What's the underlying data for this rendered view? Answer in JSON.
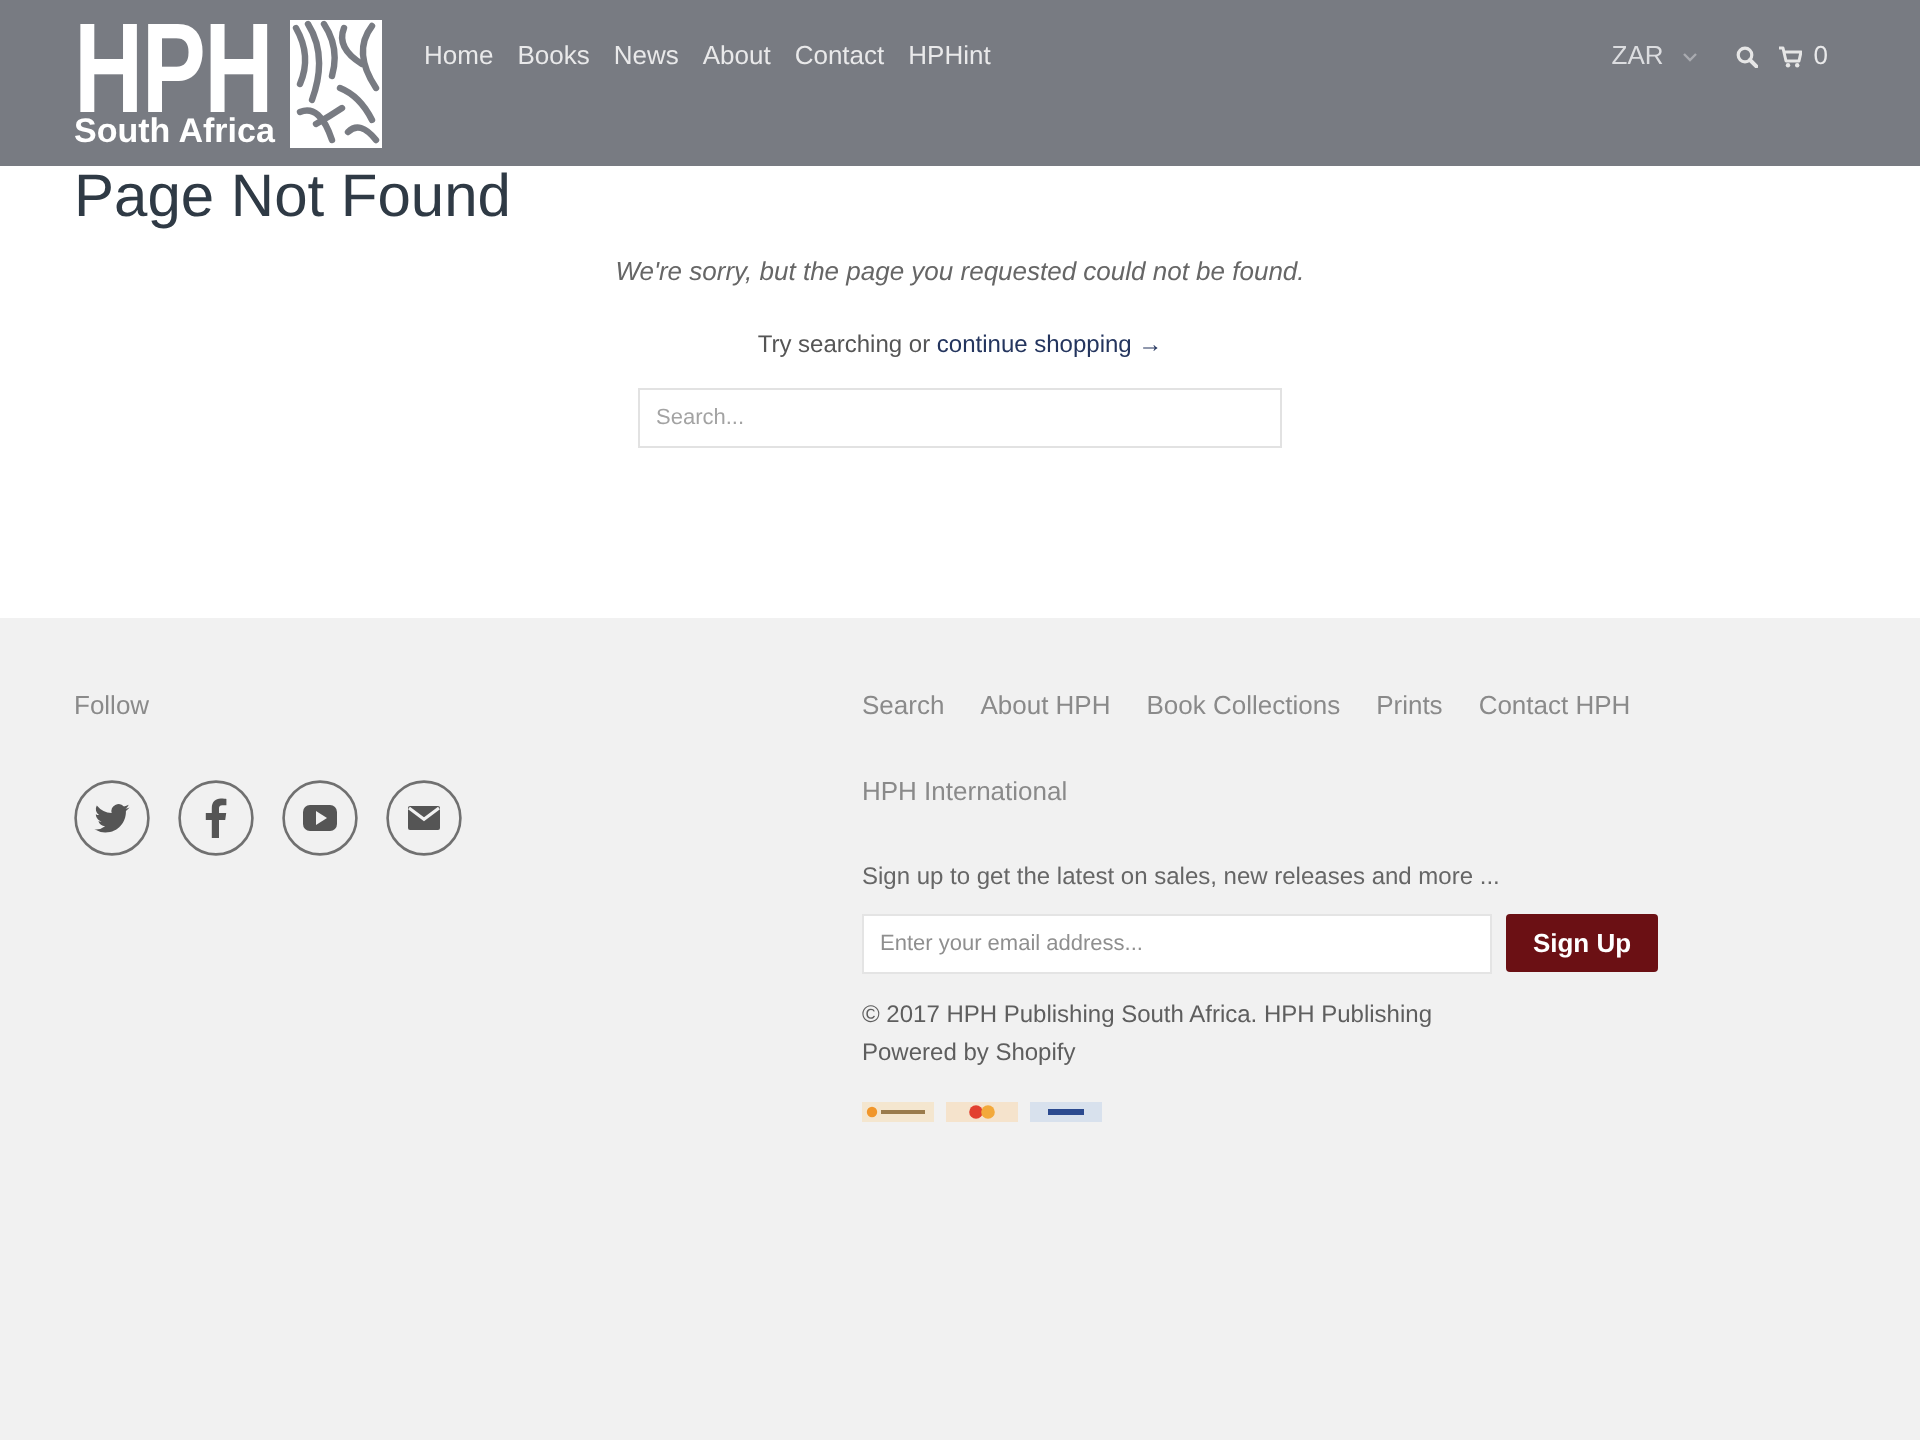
{
  "header": {
    "logo": {
      "title": "HPH",
      "subtitle": "South Africa"
    },
    "nav": [
      "Home",
      "Books",
      "News",
      "About",
      "Contact",
      "HPHint"
    ],
    "currency": "ZAR",
    "cart_count": "0"
  },
  "page": {
    "title": "Page Not Found",
    "message": "We're sorry, but the page you requested could not be found.",
    "hint": "Try searching or",
    "link": "continue shopping →",
    "search": {
      "placeholder": "Search..."
    }
  },
  "footer": {
    "follow": "Follow",
    "links": [
      "Search",
      "About HPH",
      "Book Collections",
      "Prints",
      "Contact HPH",
      "HPH International"
    ],
    "newsletter": {
      "text": "Sign up to get the latest on sales, new releases and more ...",
      "placeholder": "Enter your email address...",
      "button": "Sign Up"
    },
    "copyright": "© 2017 HPH Publishing South Africa. HPH Publishing",
    "powered": "Powered by Shopify"
  }
}
